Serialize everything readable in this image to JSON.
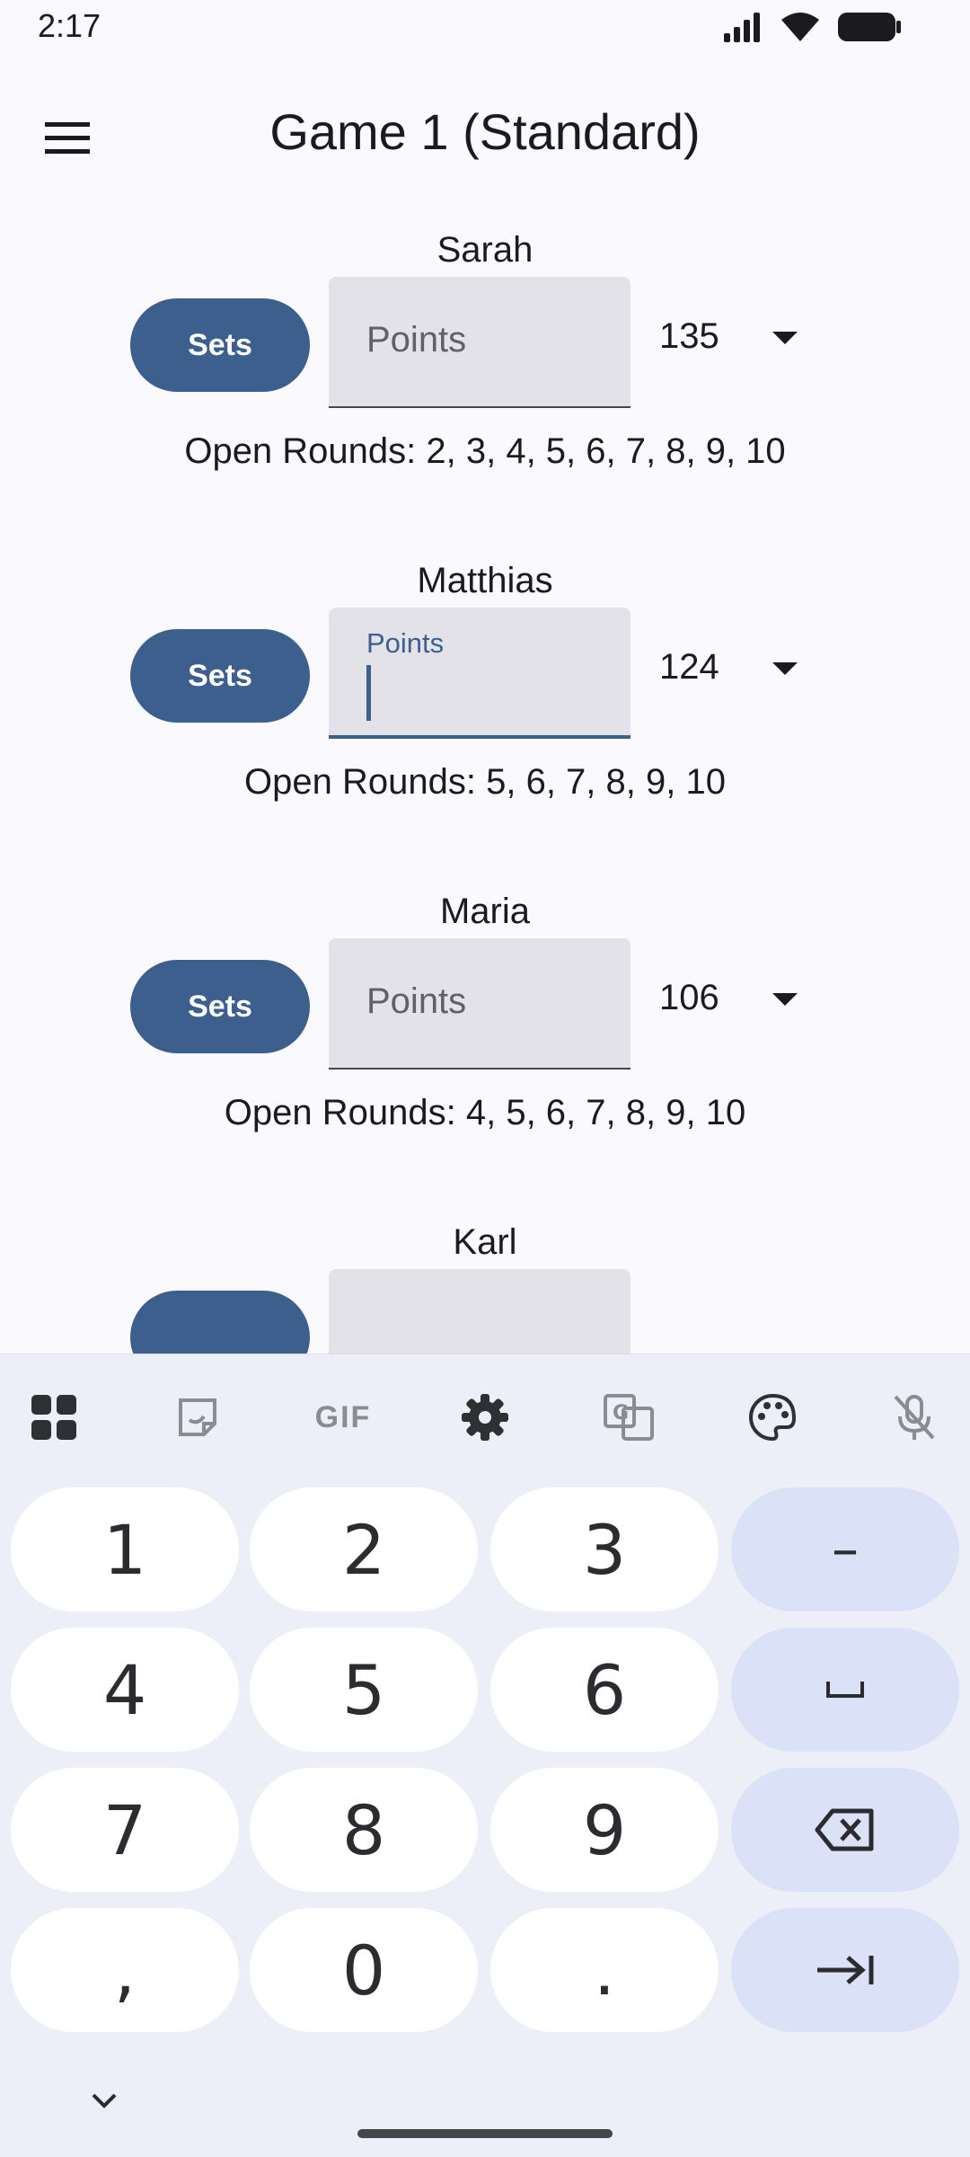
{
  "status": {
    "time": "2:17"
  },
  "app_bar": {
    "title": "Game 1 (Standard)"
  },
  "players": [
    {
      "name": "Sarah",
      "sets_label": "Sets",
      "points_placeholder": "Points",
      "score": "135",
      "open_rounds": "Open Rounds: 2, 3, 4, 5, 6, 7, 8, 9, 10"
    },
    {
      "name": "Matthias",
      "sets_label": "Sets",
      "points_label": "Points",
      "score": "124",
      "open_rounds": "Open Rounds: 5, 6, 7, 8, 9, 10"
    },
    {
      "name": "Maria",
      "sets_label": "Sets",
      "points_placeholder": "Points",
      "score": "106",
      "open_rounds": "Open Rounds: 4, 5, 6, 7, 8, 9, 10"
    },
    {
      "name": "Karl"
    }
  ],
  "keyboard": {
    "toolbar_icons": [
      "apps-grid-icon",
      "sticker-icon",
      "gif-icon",
      "settings-gear-icon",
      "translate-icon",
      "palette-icon",
      "mic-off-icon"
    ],
    "gif_label": "GIF",
    "keys": {
      "k1": "1",
      "k2": "2",
      "k3": "3",
      "minus": "–",
      "k4": "4",
      "k5": "5",
      "k6": "6",
      "space": "␣",
      "k7": "7",
      "k8": "8",
      "k9": "9",
      "comma": ",",
      "k0": "0",
      "period": "."
    }
  },
  "colors": {
    "accent": "#3c5f8e",
    "field_bg": "#e3e2e8",
    "keyboard_bg": "#eceef8",
    "fn_key": "#dbe1f6"
  }
}
